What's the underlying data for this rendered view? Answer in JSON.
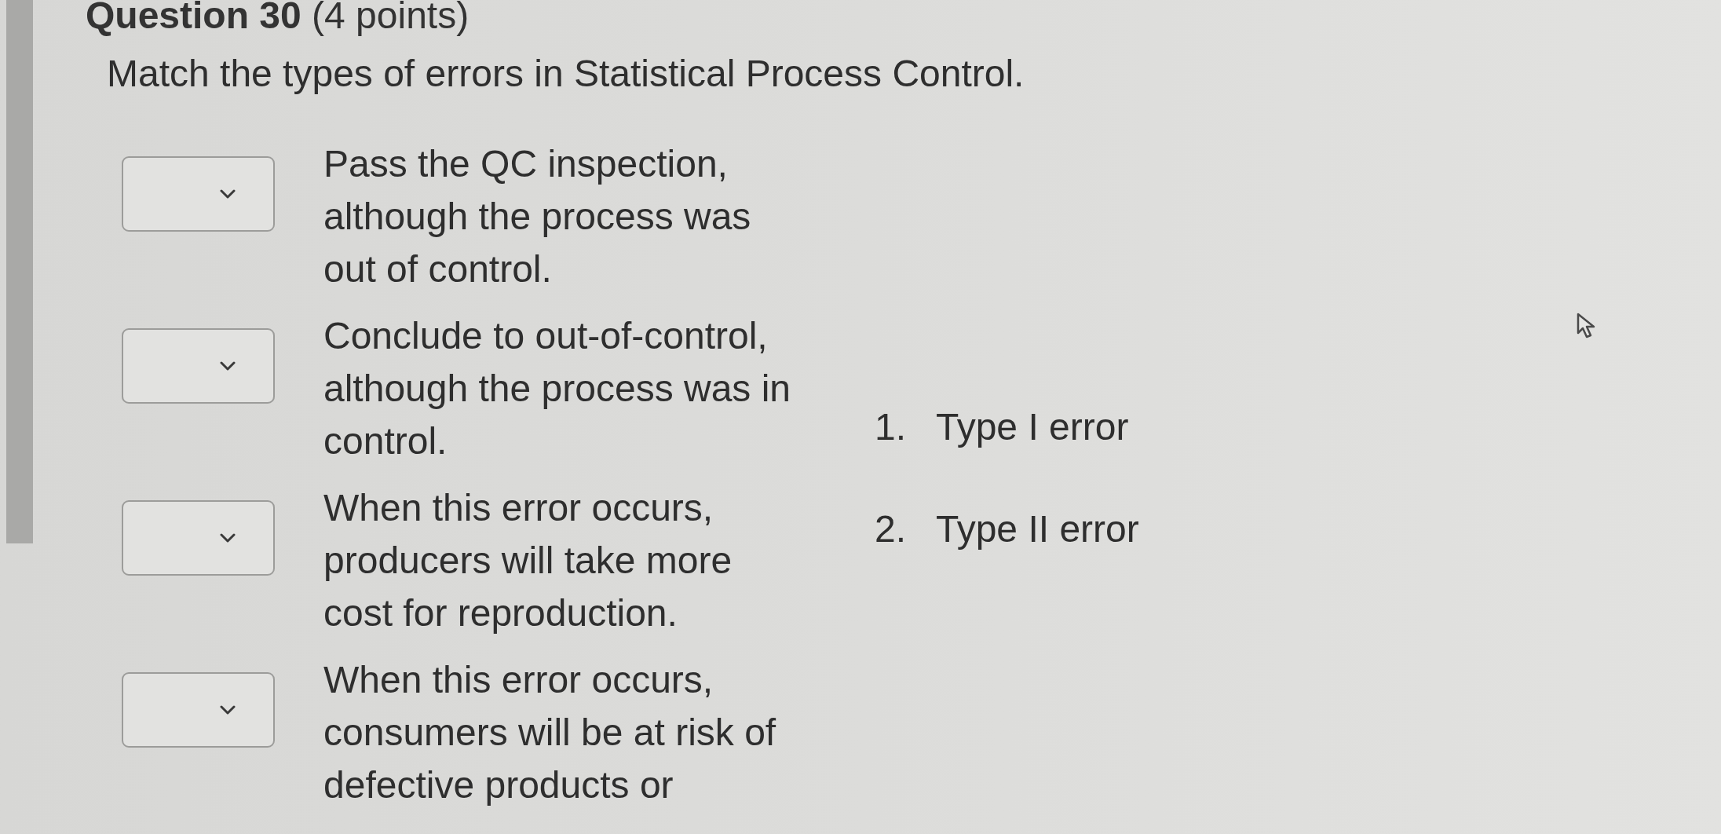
{
  "question": {
    "title": "**Question 30** (4 points)",
    "prompt": "Match the types of errors in Statistical Process Control."
  },
  "items": [
    {
      "lines": [
        "Pass the QC inspection,",
        "although the process was",
        "out of control."
      ]
    },
    {
      "lines": [
        "Conclude to out-of-control,",
        "although the process was in",
        "control."
      ]
    },
    {
      "lines": [
        "When this error occurs,",
        "producers will take more",
        "cost for reproduction."
      ]
    },
    {
      "lines": [
        "When this error occurs,",
        "consumers will be at risk of",
        "defective products or"
      ]
    }
  ],
  "choices": [
    {
      "number": "1.",
      "label": "Type I error"
    },
    {
      "number": "2.",
      "label": "Type II error"
    }
  ]
}
